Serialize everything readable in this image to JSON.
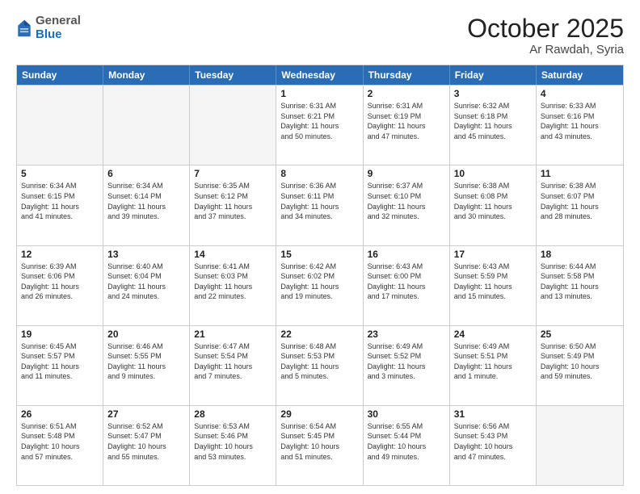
{
  "header": {
    "logo_general": "General",
    "logo_blue": "Blue",
    "month_title": "October 2025",
    "location": "Ar Rawdah, Syria"
  },
  "weekdays": [
    "Sunday",
    "Monday",
    "Tuesday",
    "Wednesday",
    "Thursday",
    "Friday",
    "Saturday"
  ],
  "rows": [
    [
      {
        "day": "",
        "info": ""
      },
      {
        "day": "",
        "info": ""
      },
      {
        "day": "",
        "info": ""
      },
      {
        "day": "1",
        "info": "Sunrise: 6:31 AM\nSunset: 6:21 PM\nDaylight: 11 hours\nand 50 minutes."
      },
      {
        "day": "2",
        "info": "Sunrise: 6:31 AM\nSunset: 6:19 PM\nDaylight: 11 hours\nand 47 minutes."
      },
      {
        "day": "3",
        "info": "Sunrise: 6:32 AM\nSunset: 6:18 PM\nDaylight: 11 hours\nand 45 minutes."
      },
      {
        "day": "4",
        "info": "Sunrise: 6:33 AM\nSunset: 6:16 PM\nDaylight: 11 hours\nand 43 minutes."
      }
    ],
    [
      {
        "day": "5",
        "info": "Sunrise: 6:34 AM\nSunset: 6:15 PM\nDaylight: 11 hours\nand 41 minutes."
      },
      {
        "day": "6",
        "info": "Sunrise: 6:34 AM\nSunset: 6:14 PM\nDaylight: 11 hours\nand 39 minutes."
      },
      {
        "day": "7",
        "info": "Sunrise: 6:35 AM\nSunset: 6:12 PM\nDaylight: 11 hours\nand 37 minutes."
      },
      {
        "day": "8",
        "info": "Sunrise: 6:36 AM\nSunset: 6:11 PM\nDaylight: 11 hours\nand 34 minutes."
      },
      {
        "day": "9",
        "info": "Sunrise: 6:37 AM\nSunset: 6:10 PM\nDaylight: 11 hours\nand 32 minutes."
      },
      {
        "day": "10",
        "info": "Sunrise: 6:38 AM\nSunset: 6:08 PM\nDaylight: 11 hours\nand 30 minutes."
      },
      {
        "day": "11",
        "info": "Sunrise: 6:38 AM\nSunset: 6:07 PM\nDaylight: 11 hours\nand 28 minutes."
      }
    ],
    [
      {
        "day": "12",
        "info": "Sunrise: 6:39 AM\nSunset: 6:06 PM\nDaylight: 11 hours\nand 26 minutes."
      },
      {
        "day": "13",
        "info": "Sunrise: 6:40 AM\nSunset: 6:04 PM\nDaylight: 11 hours\nand 24 minutes."
      },
      {
        "day": "14",
        "info": "Sunrise: 6:41 AM\nSunset: 6:03 PM\nDaylight: 11 hours\nand 22 minutes."
      },
      {
        "day": "15",
        "info": "Sunrise: 6:42 AM\nSunset: 6:02 PM\nDaylight: 11 hours\nand 19 minutes."
      },
      {
        "day": "16",
        "info": "Sunrise: 6:43 AM\nSunset: 6:00 PM\nDaylight: 11 hours\nand 17 minutes."
      },
      {
        "day": "17",
        "info": "Sunrise: 6:43 AM\nSunset: 5:59 PM\nDaylight: 11 hours\nand 15 minutes."
      },
      {
        "day": "18",
        "info": "Sunrise: 6:44 AM\nSunset: 5:58 PM\nDaylight: 11 hours\nand 13 minutes."
      }
    ],
    [
      {
        "day": "19",
        "info": "Sunrise: 6:45 AM\nSunset: 5:57 PM\nDaylight: 11 hours\nand 11 minutes."
      },
      {
        "day": "20",
        "info": "Sunrise: 6:46 AM\nSunset: 5:55 PM\nDaylight: 11 hours\nand 9 minutes."
      },
      {
        "day": "21",
        "info": "Sunrise: 6:47 AM\nSunset: 5:54 PM\nDaylight: 11 hours\nand 7 minutes."
      },
      {
        "day": "22",
        "info": "Sunrise: 6:48 AM\nSunset: 5:53 PM\nDaylight: 11 hours\nand 5 minutes."
      },
      {
        "day": "23",
        "info": "Sunrise: 6:49 AM\nSunset: 5:52 PM\nDaylight: 11 hours\nand 3 minutes."
      },
      {
        "day": "24",
        "info": "Sunrise: 6:49 AM\nSunset: 5:51 PM\nDaylight: 11 hours\nand 1 minute."
      },
      {
        "day": "25",
        "info": "Sunrise: 6:50 AM\nSunset: 5:49 PM\nDaylight: 10 hours\nand 59 minutes."
      }
    ],
    [
      {
        "day": "26",
        "info": "Sunrise: 6:51 AM\nSunset: 5:48 PM\nDaylight: 10 hours\nand 57 minutes."
      },
      {
        "day": "27",
        "info": "Sunrise: 6:52 AM\nSunset: 5:47 PM\nDaylight: 10 hours\nand 55 minutes."
      },
      {
        "day": "28",
        "info": "Sunrise: 6:53 AM\nSunset: 5:46 PM\nDaylight: 10 hours\nand 53 minutes."
      },
      {
        "day": "29",
        "info": "Sunrise: 6:54 AM\nSunset: 5:45 PM\nDaylight: 10 hours\nand 51 minutes."
      },
      {
        "day": "30",
        "info": "Sunrise: 6:55 AM\nSunset: 5:44 PM\nDaylight: 10 hours\nand 49 minutes."
      },
      {
        "day": "31",
        "info": "Sunrise: 6:56 AM\nSunset: 5:43 PM\nDaylight: 10 hours\nand 47 minutes."
      },
      {
        "day": "",
        "info": ""
      }
    ]
  ]
}
